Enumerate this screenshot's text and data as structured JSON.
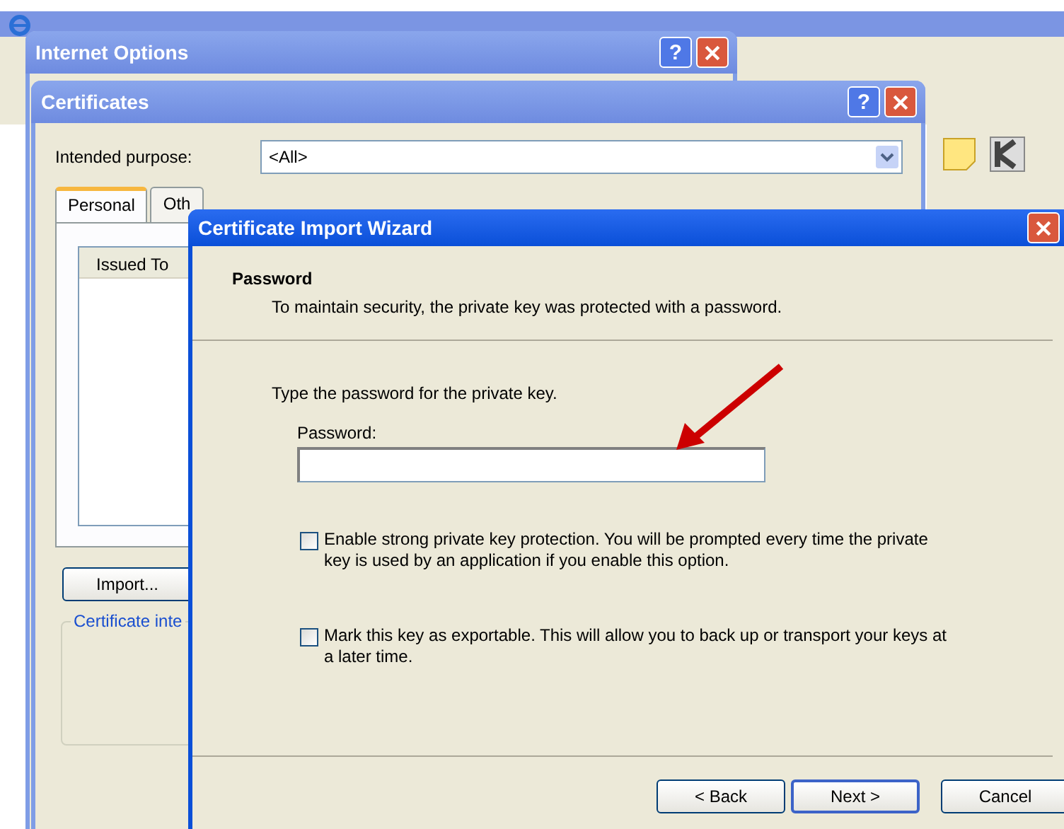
{
  "internet_options": {
    "title": "Internet Options",
    "help": "?"
  },
  "certificates": {
    "title": "Certificates",
    "help": "?",
    "purpose_label": "Intended purpose:",
    "purpose_value": "<All>",
    "tabs": [
      {
        "label": "Personal",
        "selected": true
      },
      {
        "label": "Oth",
        "selected": false
      }
    ],
    "list_column": "Issued To",
    "import_button": "Import...",
    "group_label": "Certificate inte"
  },
  "wizard": {
    "title": "Certificate Import Wizard",
    "heading": "Password",
    "subheading": "To maintain security, the private key was protected with a password.",
    "prompt": "Type the password for the private key.",
    "password_label": "Password:",
    "options": [
      {
        "label": "Enable strong private key protection. You will be prompted every time the private key is used by an application if you enable this option.",
        "checked": false
      },
      {
        "label": "Mark this key as exportable. This will allow you to back up or transport your keys at a later time.",
        "checked": false
      }
    ],
    "buttons": [
      {
        "label": "< Back",
        "default": false
      },
      {
        "label": "Next >",
        "default": true
      },
      {
        "label": "Cancel",
        "default": false
      }
    ]
  }
}
